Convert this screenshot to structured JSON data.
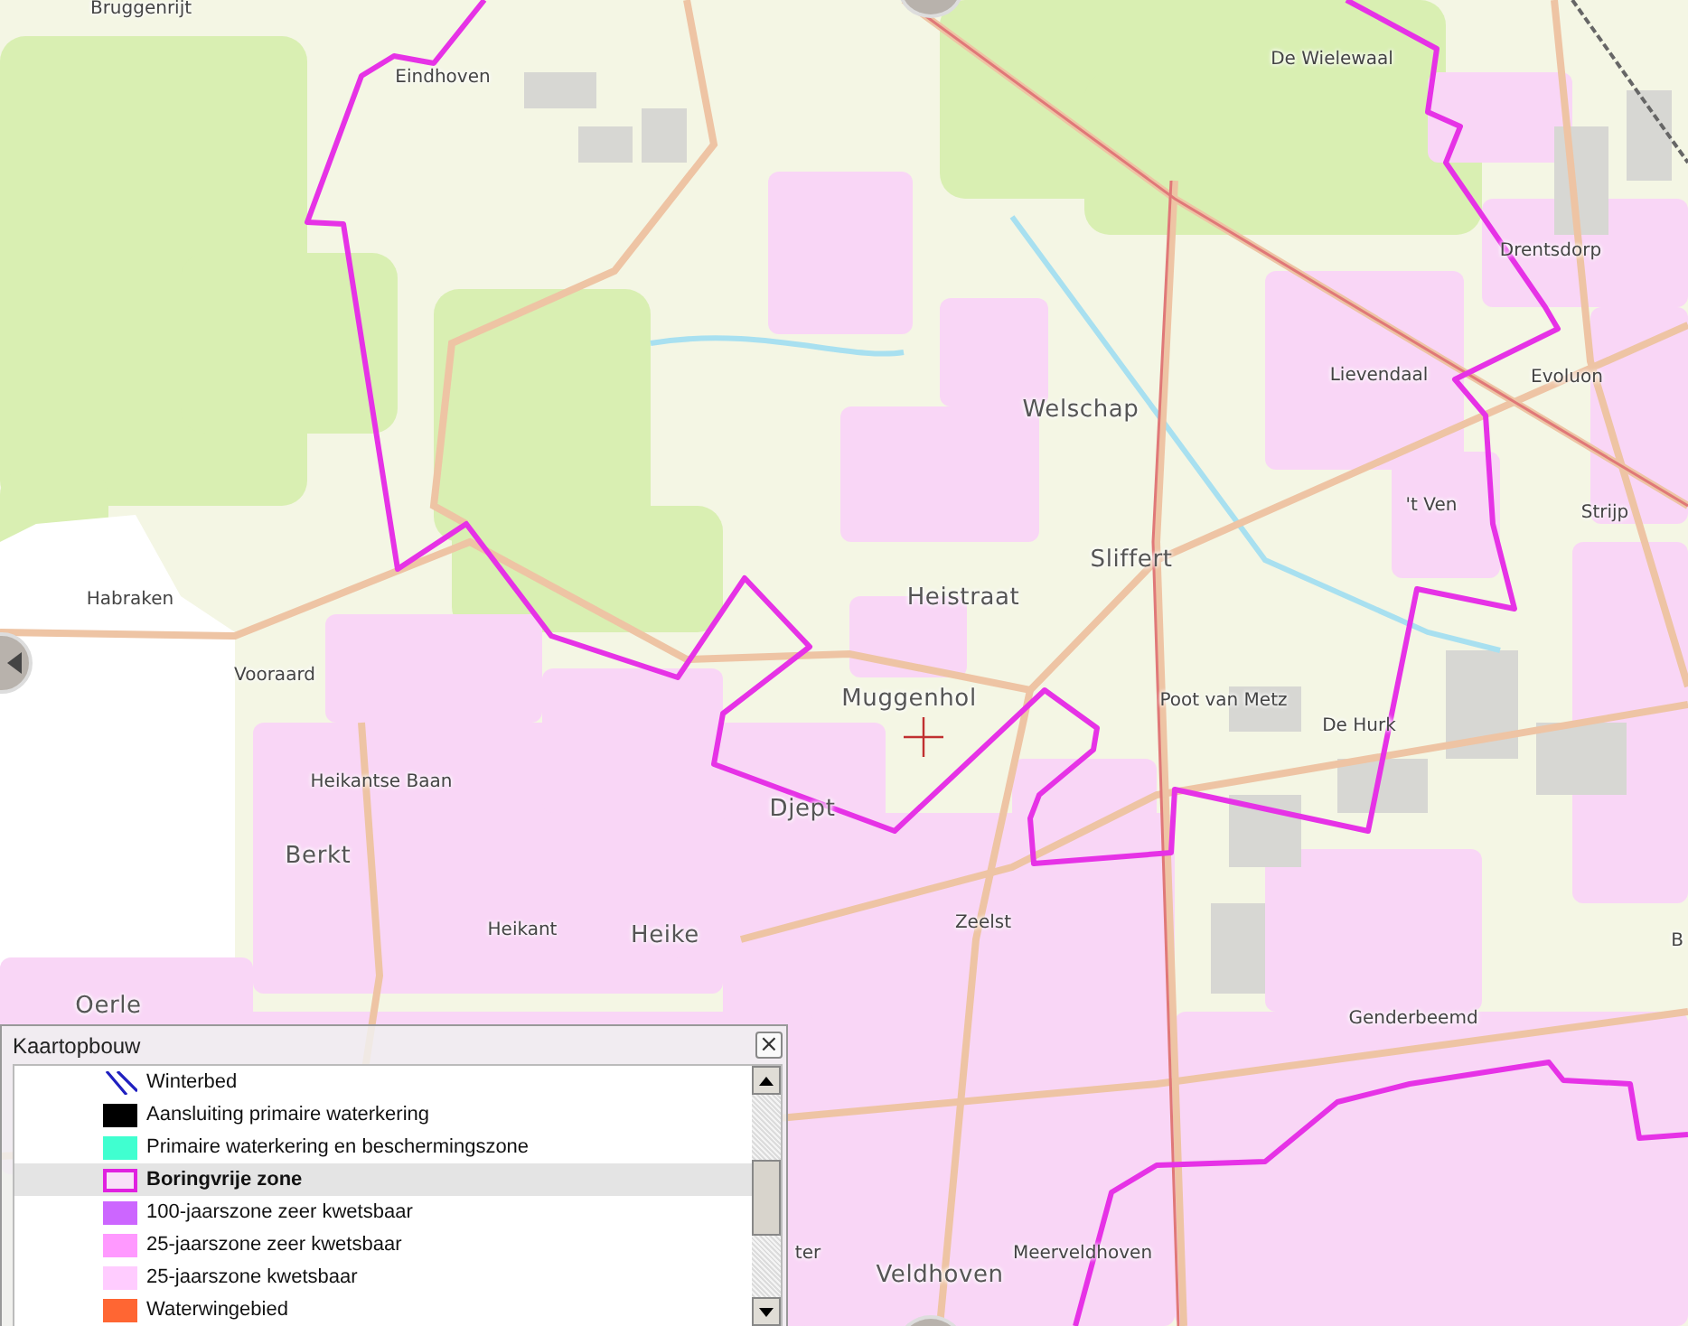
{
  "map": {
    "labels": [
      {
        "text": "Bruggenrijt",
        "kind": "small"
      },
      {
        "text": "Eindhoven",
        "kind": "small"
      },
      {
        "text": "De Wielewaal",
        "kind": "small"
      },
      {
        "text": "Drentsdorp",
        "kind": "small"
      },
      {
        "text": "Lievendaal",
        "kind": "small"
      },
      {
        "text": "Evoluon",
        "kind": "small"
      },
      {
        "text": "Welschap",
        "kind": "large"
      },
      {
        "text": "'t Ven",
        "kind": "small"
      },
      {
        "text": "Strijp",
        "kind": "small"
      },
      {
        "text": "Sliffert",
        "kind": "large"
      },
      {
        "text": "Heistraat",
        "kind": "large"
      },
      {
        "text": "Habraken",
        "kind": "small"
      },
      {
        "text": "Vooraard",
        "kind": "small"
      },
      {
        "text": "Muggenhol",
        "kind": "large"
      },
      {
        "text": "Poot van Metz",
        "kind": "small"
      },
      {
        "text": "De Hurk",
        "kind": "small"
      },
      {
        "text": "Heikantse Baan",
        "kind": "small"
      },
      {
        "text": "Djept",
        "kind": "large"
      },
      {
        "text": "Berkt",
        "kind": "large"
      },
      {
        "text": "Heikant",
        "kind": "small"
      },
      {
        "text": "Heike",
        "kind": "large"
      },
      {
        "text": "Zeelst",
        "kind": "small"
      },
      {
        "text": "Oerle",
        "kind": "large"
      },
      {
        "text": "B",
        "kind": "small"
      },
      {
        "text": "Genderbeemd",
        "kind": "small"
      },
      {
        "text": "ter",
        "kind": "small"
      },
      {
        "text": "Meerveldhoven",
        "kind": "small"
      },
      {
        "text": "Veldhoven",
        "kind": "large"
      }
    ]
  },
  "legend": {
    "title": "Kaartopbouw",
    "close": "×",
    "items": [
      {
        "label": "Winterbed",
        "kind": "hatch",
        "color": "#2020c0",
        "selected": false
      },
      {
        "label": "Aansluiting primaire waterkering",
        "kind": "fill",
        "color": "#000000",
        "selected": false
      },
      {
        "label": "Primaire waterkering en beschermingszone",
        "kind": "fill",
        "color": "#40ffd0",
        "selected": false
      },
      {
        "label": "Boringvrije zone",
        "kind": "outline",
        "color": "#e020e0",
        "selected": true
      },
      {
        "label": "100-jaarszone zeer kwetsbaar",
        "kind": "fill",
        "color": "#cc66ff",
        "selected": false
      },
      {
        "label": "25-jaarszone zeer kwetsbaar",
        "kind": "fill",
        "color": "#ff99ff",
        "selected": false
      },
      {
        "label": "25-jaarszone kwetsbaar",
        "kind": "fill",
        "color": "#ffccff",
        "selected": false
      },
      {
        "label": "Waterwingebied",
        "kind": "fill",
        "color": "#ff6633",
        "selected": false
      }
    ]
  }
}
